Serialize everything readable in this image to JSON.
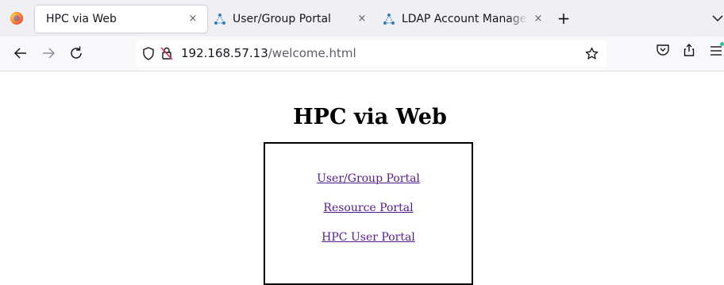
{
  "browser": {
    "tabs": [
      {
        "title": "HPC via Web",
        "active": true
      },
      {
        "title": "User/Group Portal",
        "active": false
      },
      {
        "title": "LDAP Account Manager",
        "active": false
      }
    ],
    "close_glyph": "×",
    "new_tab_glyph": "+",
    "url_domain": "192.168.57.13",
    "url_path": "/welcome.html",
    "icons": [
      "firefox-logo-icon",
      "network-favicon-icon",
      "close-icon",
      "plus-icon",
      "chevron-down-icon",
      "back-arrow-icon",
      "forward-arrow-icon",
      "reload-icon",
      "shield-icon",
      "insecure-lock-icon",
      "bookmark-star-icon",
      "pocket-icon",
      "share-icon",
      "hamburger-menu-icon"
    ]
  },
  "page": {
    "title": "HPC via Web",
    "links": [
      "User/Group Portal",
      "Resource Portal",
      "HPC User Portal"
    ],
    "link_color": "#551a8b"
  },
  "colors": {
    "tabstrip_bg": "#f0f0f4",
    "navbar_bg": "#f9f9fb",
    "favicon_blue": "#2c7fbd",
    "update_dot": "#2ac3a2"
  }
}
